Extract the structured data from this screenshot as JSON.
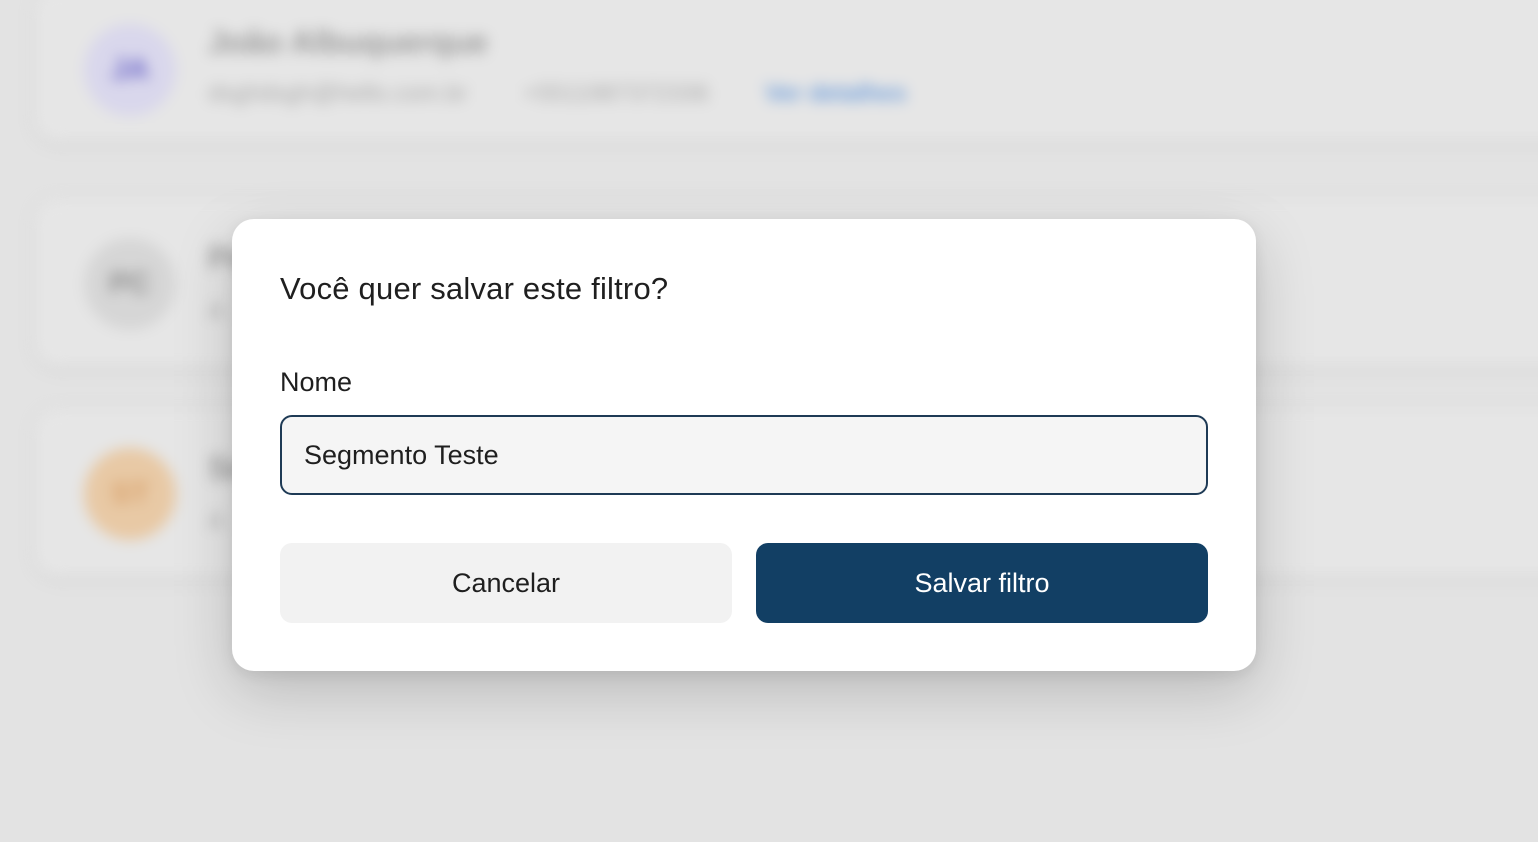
{
  "background": {
    "contacts": [
      {
        "initials": "JA",
        "name": "João Albuquerque",
        "email": "dsghdsgh@hello.com.br",
        "phone": "+5511987372336",
        "link": "Ver detalhes"
      },
      {
        "initials": "PC",
        "name": "Pe",
        "email": "A"
      },
      {
        "initials": "ST",
        "name": "Se",
        "email": "A"
      }
    ]
  },
  "modal": {
    "title": "Você quer salvar este filtro?",
    "name_label": "Nome",
    "name_value": "Segmento Teste",
    "cancel_label": "Cancelar",
    "save_label": "Salvar filtro"
  },
  "colors": {
    "primary": "#123f64",
    "input_border": "#1e3a55",
    "cancel_bg": "#f2f2f2",
    "overlay_bg": "#e3e3e3"
  }
}
